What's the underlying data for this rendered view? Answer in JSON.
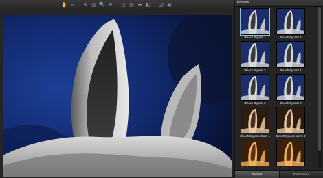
{
  "toolbar": {
    "icons": [
      {
        "name": "hand-tool-icon",
        "glyph": "✋"
      },
      {
        "name": "zoom-fit-icon",
        "glyph": "▭"
      },
      {
        "name": "zoom-in-icon",
        "glyph": "⊕"
      },
      {
        "name": "compare-icon",
        "glyph": "▥"
      },
      {
        "name": "zoom-icon",
        "glyph": "🔍"
      },
      {
        "name": "pan-icon",
        "glyph": "✥"
      },
      {
        "name": "split-view-icon",
        "glyph": "◫"
      },
      {
        "name": "side-by-side-icon",
        "glyph": "▤"
      },
      {
        "name": "single-view-icon",
        "glyph": "▬"
      },
      {
        "name": "before-after-icon",
        "glyph": "◧"
      },
      {
        "name": "histogram-icon",
        "glyph": "◿"
      },
      {
        "name": "preview-icon",
        "glyph": "▣"
      }
    ]
  },
  "panel": {
    "title": "Presets",
    "presets": [
      {
        "label": "Bleach Bypass 1",
        "tone": "cool"
      },
      {
        "label": "Bleach Bypass 2",
        "tone": "cool"
      },
      {
        "label": "Bleach Bypass 3",
        "tone": "cool"
      },
      {
        "label": "Bleach Bypass 4",
        "tone": "cool"
      },
      {
        "label": "Bleach Bypass 5",
        "tone": "cool"
      },
      {
        "label": "Bleach Bypass 6",
        "tone": "cool"
      },
      {
        "label": "Bleach Bypass Warm 1",
        "tone": "warm"
      },
      {
        "label": "Bleach Bypass Warm 2",
        "tone": "warm"
      },
      {
        "label": "Bleach Bypass Warm 3",
        "tone": "warmer"
      },
      {
        "label": "Bleach Bypass Warm 4",
        "tone": "warmer"
      }
    ],
    "tabs": [
      {
        "label": "Presets",
        "active": true
      },
      {
        "label": "Parameters",
        "active": false
      }
    ]
  }
}
